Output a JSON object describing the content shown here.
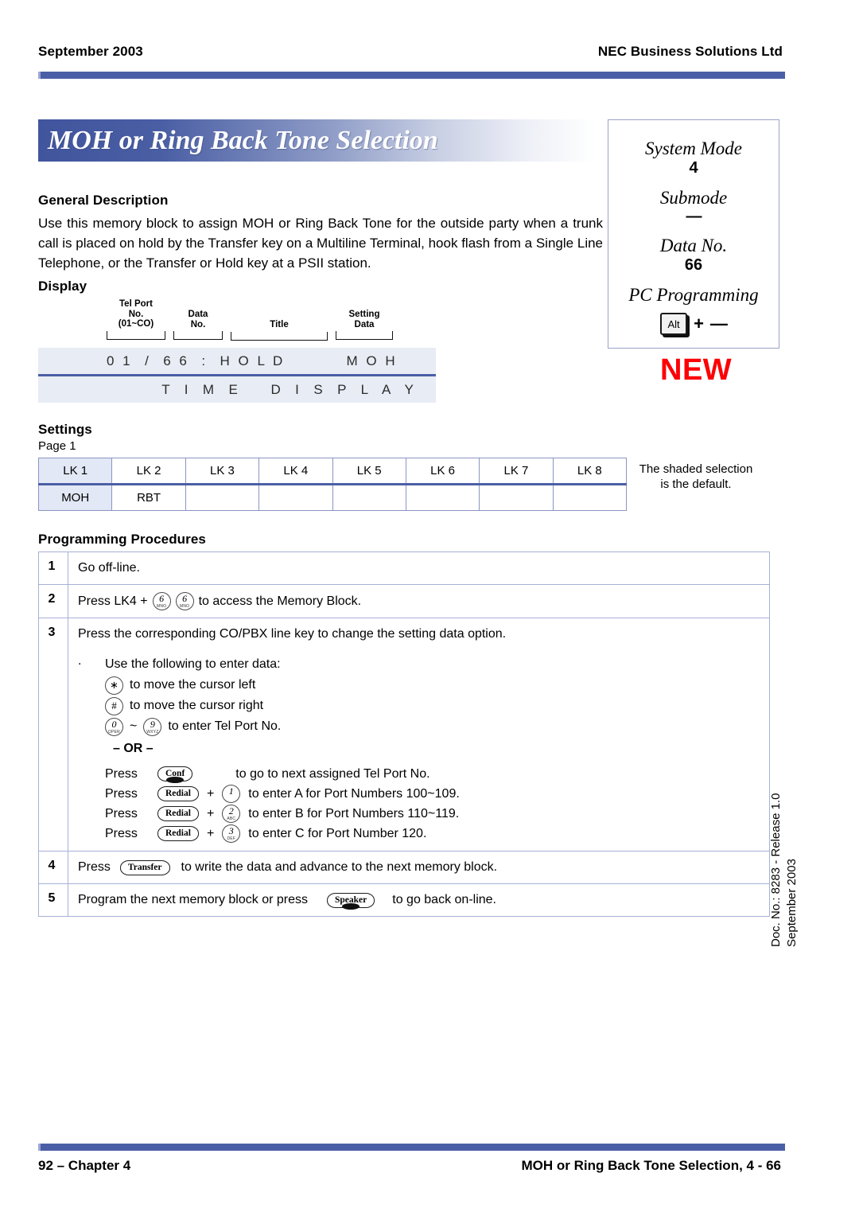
{
  "header": {
    "date": "September 2003",
    "company": "NEC Business Solutions Ltd"
  },
  "title": "MOH or Ring Back Tone Selection",
  "mode_box": {
    "system_mode_label": "System Mode",
    "system_mode_value": "4",
    "submode_label": "Submode",
    "submode_value": "—",
    "data_no_label": "Data No.",
    "data_no_value": "66",
    "pc_programming_label": "PC Programming",
    "alt_key": "Alt",
    "plus": "+",
    "pc_value": "—"
  },
  "new_badge": "NEW",
  "general": {
    "heading": "General Description",
    "text": "Use this memory block to assign MOH or Ring Back Tone for the outside party when a trunk call is placed on hold by the Transfer key on a Multiline Terminal, hook flash from a Single Line Telephone, or the Transfer or Hold key at a PSII station."
  },
  "display": {
    "heading": "Display",
    "brackets": [
      {
        "line1": "Tel Port",
        "line2": "No.",
        "line3": "(01~CO)"
      },
      {
        "line1": "Data",
        "line2": "No.",
        "line3": ""
      },
      {
        "line1": "Title",
        "line2": "",
        "line3": ""
      },
      {
        "line1": "Setting",
        "line2": "Data",
        "line3": ""
      }
    ],
    "line1": "0 1  /  6 6  :  H O L D          M O H",
    "line2": "         T  I  M  E     D  I  S  P  L  A  Y"
  },
  "settings": {
    "heading": "Settings",
    "page_label": "Page 1",
    "columns": [
      "LK 1",
      "LK 2",
      "LK 3",
      "LK 4",
      "LK 5",
      "LK 6",
      "LK 7",
      "LK 8"
    ],
    "values": [
      "MOH",
      "RBT",
      "",
      "",
      "",
      "",
      "",
      ""
    ],
    "default_column_index": 0,
    "note": "The shaded selection is the default."
  },
  "procedures": {
    "heading": "Programming Procedures",
    "step1": {
      "num": "1",
      "text": "Go off-line."
    },
    "step2": {
      "num": "2",
      "prefix": "Press LK4 +",
      "key_a_digit": "6",
      "key_a_sub": "MNO",
      "key_b_digit": "6",
      "key_b_sub": "MNO",
      "suffix": "to access the Memory Block."
    },
    "step3": {
      "num": "3",
      "text": "Press the corresponding CO/PBX line key to change the setting data option.",
      "dot": ".",
      "sub_heading": "Use the following to enter data:",
      "cursor_left": {
        "key": "∗",
        "text": "to move the cursor left"
      },
      "cursor_right": {
        "key": "#",
        "text": "to move the cursor right"
      },
      "digits": {
        "from_digit": "0",
        "from_sub": "OPER",
        "tilde": "~",
        "to_digit": "9",
        "to_sub": "WXYZ",
        "text": "to enter Tel Port No."
      },
      "or_label": "– OR –",
      "press_rows": [
        {
          "press": "Press",
          "key": "Conf",
          "plus": "",
          "digit": "",
          "digit_sub": "",
          "text": "to go to next assigned Tel Port No."
        },
        {
          "press": "Press",
          "key": "Redial",
          "plus": "+",
          "digit": "1",
          "digit_sub": "",
          "text": "to enter A for Port Numbers 100~109."
        },
        {
          "press": "Press",
          "key": "Redial",
          "plus": "+",
          "digit": "2",
          "digit_sub": "ABC",
          "text": "to enter B for Port Numbers 110~119."
        },
        {
          "press": "Press",
          "key": "Redial",
          "plus": "+",
          "digit": "3",
          "digit_sub": "DEF",
          "text": "to enter C for Port Number 120."
        }
      ]
    },
    "step4": {
      "num": "4",
      "prefix": "Press",
      "key": "Transfer",
      "suffix": "to write the data and advance to the next memory block."
    },
    "step5": {
      "num": "5",
      "prefix": "Program the next memory block or press",
      "key": "Speaker",
      "suffix": "to go back on-line."
    }
  },
  "side_text": {
    "line1": "Doc. No.: 8283 - Release 1.0",
    "line2": "September 2003"
  },
  "footer": {
    "left": "92 – Chapter 4",
    "right": "MOH or Ring Back Tone Selection, 4 - 66"
  }
}
